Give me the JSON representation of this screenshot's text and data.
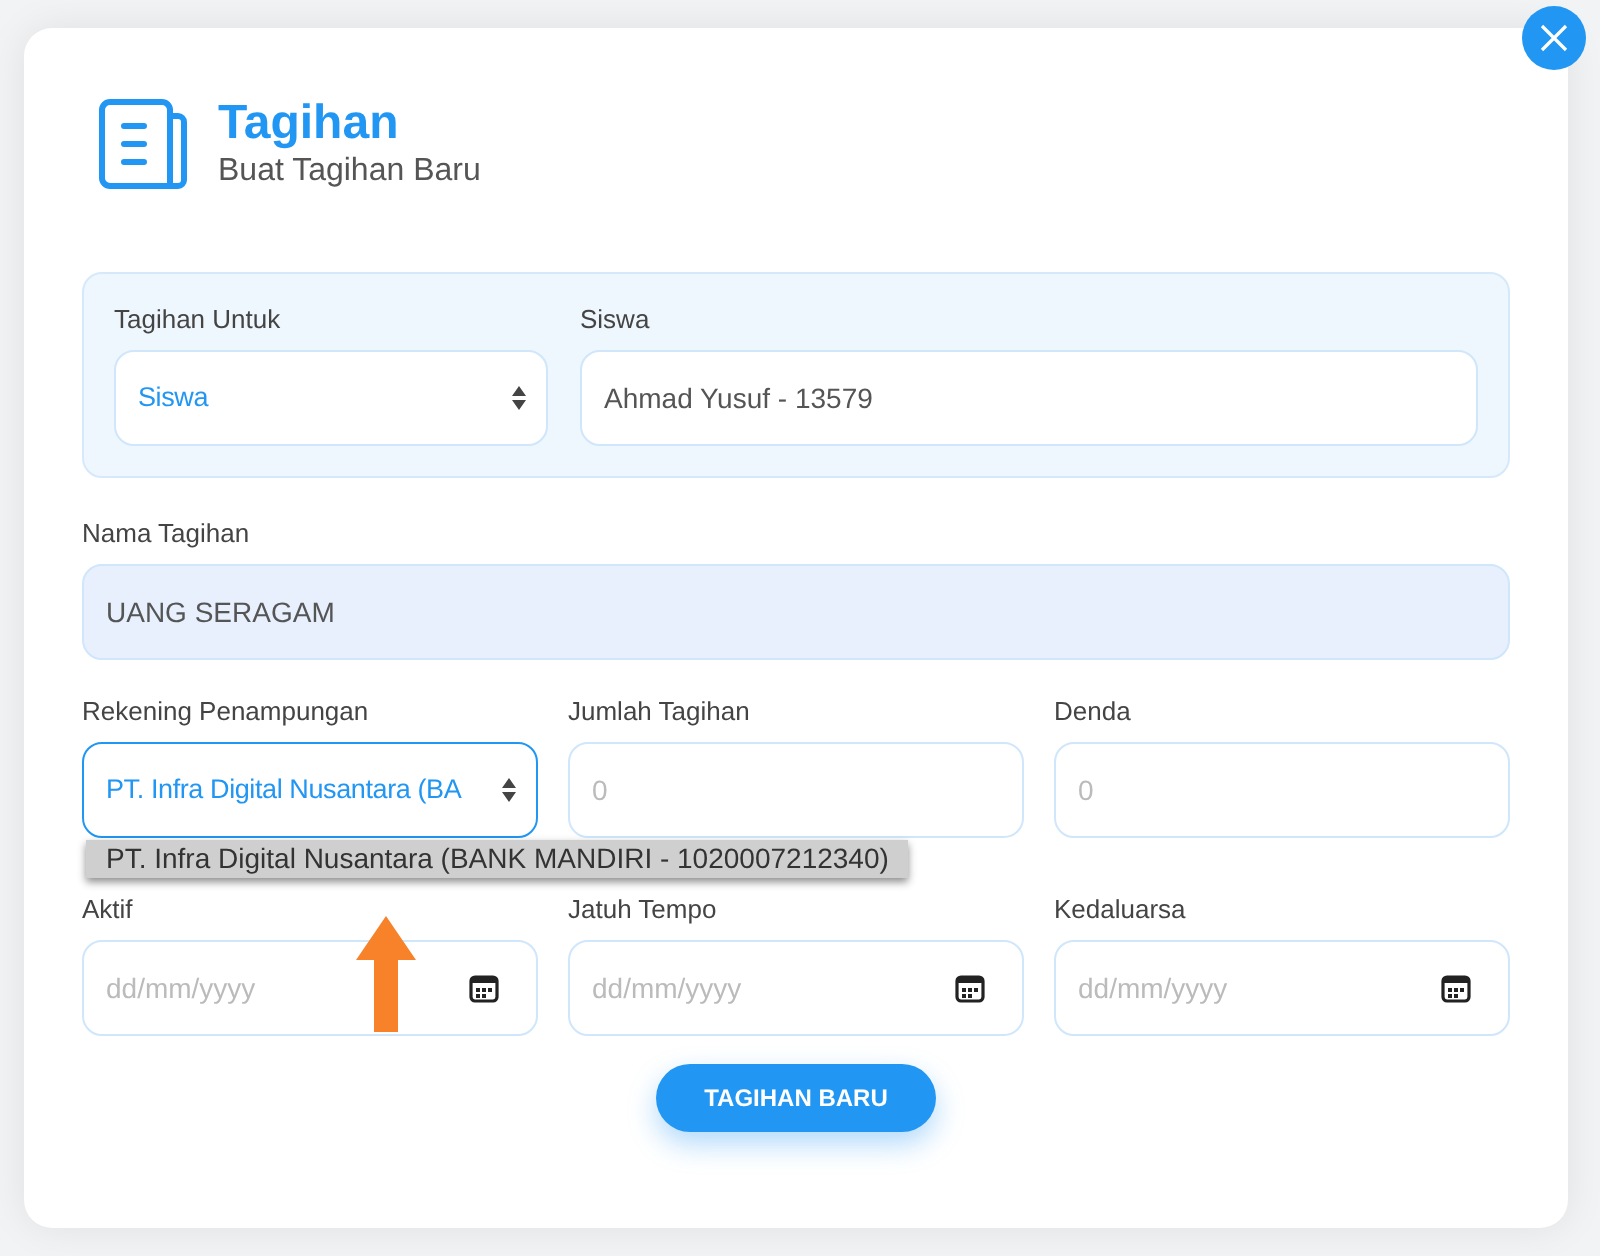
{
  "header": {
    "title": "Tagihan",
    "subtitle": "Buat Tagihan Baru"
  },
  "target_panel": [
    {
      "kind": "select",
      "label": "Tagihan Untuk",
      "value": "Siswa",
      "focused": false
    },
    {
      "kind": "text",
      "label": "Siswa",
      "value": "Ahmad Yusuf - 13579",
      "focused": false
    }
  ],
  "nama_tagihan": {
    "kind": "text",
    "label": "Nama Tagihan",
    "value": "UANG SERAGAM",
    "autofilled": true,
    "focused": false
  },
  "row_amounts": [
    {
      "kind": "select",
      "label": "Rekening Penampungan",
      "value": "PT. Infra Digital Nusantara (BA",
      "focused": true,
      "open": true,
      "options": [
        {
          "label": "PT. Infra Digital Nusantara (BANK MANDIRI - 1020007212340)",
          "selected": true
        }
      ]
    },
    {
      "kind": "text",
      "label": "Jumlah Tagihan",
      "placeholder": "0",
      "focused": false
    },
    {
      "kind": "text",
      "label": "Denda",
      "placeholder": "0",
      "focused": false
    }
  ],
  "row_dates": [
    {
      "kind": "date",
      "label": "Aktif",
      "placeholder": "dd/mm/yyyy",
      "focused": false
    },
    {
      "kind": "date",
      "label": "Jatuh Tempo",
      "placeholder": "dd/mm/yyyy",
      "focused": false
    },
    {
      "kind": "date",
      "label": "Kedaluarsa",
      "placeholder": "dd/mm/yyyy",
      "focused": false
    }
  ],
  "submit_button": "TAGIHAN BARU"
}
